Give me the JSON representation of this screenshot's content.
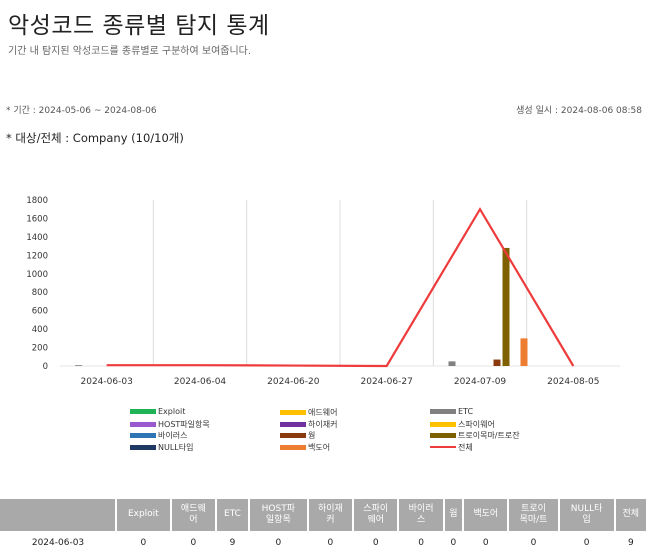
{
  "header": {
    "title": "악성코드 종류별 탐지 통계",
    "subtitle": "기간 내 탐지된 악성코드를 종류별로 구분하여 보여줍니다."
  },
  "meta": {
    "period": "* 기간 : 2024-05-06 ~ 2024-08-06",
    "created": "생성 일시 : 2024-08-06 08:58",
    "target": "* 대상/전체 : Company (10/10개)"
  },
  "colors": {
    "Exploit": "#1fb356",
    "애드웨어": "#ffc000",
    "ETC": "#808080",
    "HOST파일항목": "#9b59d0",
    "하이재커": "#7030a0",
    "스파이웨어": "#ffc000",
    "바이러스": "#2e75b6",
    "웜": "#8b3a0e",
    "트로이목마/트로잔": "#7f6000",
    "NULL타입": "#203864",
    "백도어": "#ed7d31",
    "전체": "#ee3b3b"
  },
  "chart_data": {
    "type": "bar",
    "categories": [
      "2024-06-03",
      "2024-06-04",
      "2024-06-20",
      "2024-06-27",
      "2024-07-09",
      "2024-08-05"
    ],
    "ylim": [
      0,
      1800
    ],
    "yticks": [
      0,
      200,
      400,
      600,
      800,
      1000,
      1200,
      1400,
      1600,
      1800
    ],
    "series": [
      {
        "name": "Exploit",
        "values": [
          0,
          0,
          0,
          0,
          0,
          0
        ]
      },
      {
        "name": "애드웨어",
        "values": [
          0,
          0,
          0,
          0,
          0,
          0
        ]
      },
      {
        "name": "ETC",
        "values": [
          9,
          0,
          0,
          0,
          50,
          0
        ]
      },
      {
        "name": "HOST파일항목",
        "values": [
          0,
          0,
          0,
          0,
          0,
          0
        ]
      },
      {
        "name": "하이재커",
        "values": [
          0,
          0,
          0,
          0,
          0,
          0
        ]
      },
      {
        "name": "스파이웨어",
        "values": [
          0,
          0,
          0,
          0,
          0,
          0
        ]
      },
      {
        "name": "바이러스",
        "values": [
          0,
          0,
          0,
          0,
          0,
          0
        ]
      },
      {
        "name": "웜",
        "values": [
          0,
          0,
          0,
          0,
          70,
          0
        ]
      },
      {
        "name": "트로이목마/트로잔",
        "values": [
          0,
          0,
          0,
          0,
          1280,
          0
        ]
      },
      {
        "name": "NULL타입",
        "values": [
          0,
          0,
          0,
          0,
          0,
          0
        ]
      },
      {
        "name": "백도어",
        "values": [
          0,
          0,
          0,
          0,
          300,
          0
        ]
      },
      {
        "name": "전체",
        "type": "line",
        "values": [
          9,
          9,
          5,
          0,
          1700,
          0
        ]
      }
    ]
  },
  "table": {
    "headers": [
      "",
      "Exploit",
      "애드웨\n어",
      "ETC",
      "HOST파\n일항목",
      "하이재\n커",
      "스파이\n웨어",
      "바이러\n스",
      "웜",
      "백도어",
      "트로이\n목마/트",
      "NULL타\n입",
      "전체"
    ],
    "rows": [
      [
        "2024-06-03",
        "0",
        "0",
        "9",
        "0",
        "0",
        "0",
        "0",
        "0",
        "0",
        "0",
        "0",
        "9"
      ]
    ]
  }
}
